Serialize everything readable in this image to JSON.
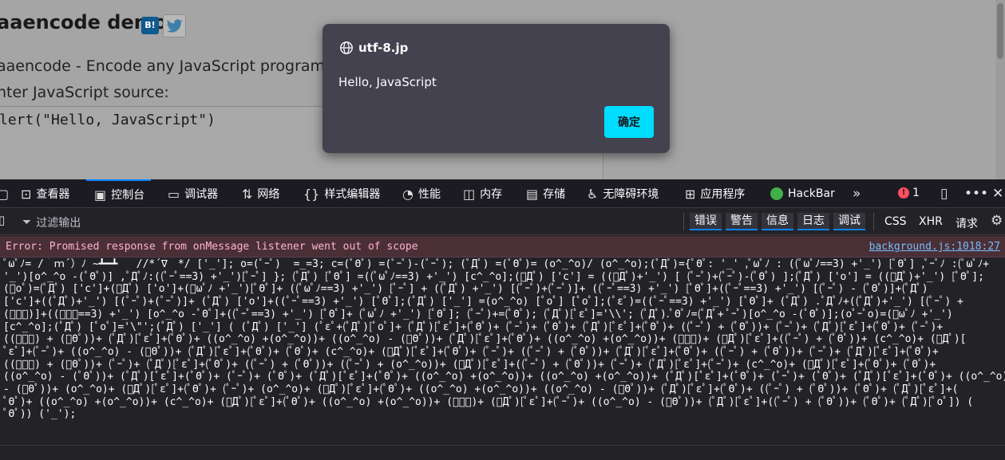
{
  "page": {
    "title": "aaencode demo",
    "hatena_label": "B!",
    "description": "aaencode - Encode any JavaScript program to",
    "source_label": "nter JavaScript source:",
    "source_value": "lert(\"Hello, JavaScript\")"
  },
  "dialog": {
    "host": "utf-8.jp",
    "message": "Hello, JavaScript",
    "ok_label": "确定"
  },
  "devtools": {
    "tabs": [
      {
        "label": "查看器",
        "icon": "inspector-icon"
      },
      {
        "label": "控制台",
        "icon": "console-icon"
      },
      {
        "label": "调试器",
        "icon": "debugger-icon"
      },
      {
        "label": "网络",
        "icon": "network-icon"
      },
      {
        "label": "样式编辑器",
        "icon": "style-editor-icon"
      },
      {
        "label": "性能",
        "icon": "performance-icon"
      },
      {
        "label": "内存",
        "icon": "memory-icon"
      },
      {
        "label": "存储",
        "icon": "storage-icon"
      },
      {
        "label": "无障碍环境",
        "icon": "accessibility-icon"
      },
      {
        "label": "应用程序",
        "icon": "application-icon"
      },
      {
        "label": "HackBar",
        "icon": "hackbar-icon"
      }
    ],
    "active_tab": "控制台",
    "error_count": "1",
    "filter_placeholder": "过滤输出",
    "levels": [
      "错误",
      "警告",
      "信息",
      "日志",
      "调试"
    ],
    "extra_filters": [
      "CSS",
      "XHR",
      "请求"
    ]
  },
  "console": {
    "error_message": "Error: Promised response from onMessage listener went out of scope",
    "error_source": "background.js:1018:27",
    "output_lines": [
      "ﾟωﾟﾉ= /｀ｍ´）ﾉ ~┻━┻   //*´∇｀*/ ['_']; o=(ﾟｰﾟ)  =_=3; c=(ﾟΘﾟ) =(ﾟｰﾟ)-(ﾟｰﾟ); (ﾟДﾟ) =(ﾟΘﾟ)= (o^_^o)/ (o^_^o);(ﾟДﾟ)={ﾟΘﾟ: '_' ,ﾟωﾟﾉ : ((ﾟωﾟﾉ==3) +'_') [ﾟΘﾟ] ,ﾟｰﾟﾉ :(ﾟωﾟﾉ+",
      "'_')[o^_^o -(ﾟΘﾟ)] ,ﾟДﾟﾉ:((ﾟｰﾟ==3) +'_')[ﾟｰﾟ] }; (ﾟДﾟ) [ﾟΘﾟ] =((ﾟωﾟﾉ==3) +'_') [c^_^o];(ﾟДﾟ) ['c'] = ((ﾟДﾟ)+'_') [ (ﾟｰﾟ)+(ﾟｰﾟ)-(ﾟΘﾟ) ];(ﾟДﾟ) ['o'] = ((ﾟДﾟ)+'_') [ﾟΘﾟ];",
      "(ﾟoﾟ)=(ﾟДﾟ) ['c']+(ﾟДﾟ) ['o']+(ﾟωﾟﾉ +'_')[ﾟΘﾟ]+ ((ﾟωﾟﾉ==3) +'_') [ﾟｰﾟ] + ((ﾟДﾟ) +'_') [(ﾟｰﾟ)+(ﾟｰﾟ)]+ ((ﾟｰﾟ==3) +'_') [ﾟΘﾟ]+((ﾟｰﾟ==3) +'_') [(ﾟｰﾟ) - (ﾟΘﾟ)]+(ﾟДﾟ)",
      "['c']+((ﾟДﾟ)+'_') [(ﾟｰﾟ)+(ﾟｰﾟ)]+ (ﾟДﾟ) ['o']+((ﾟｰﾟ==3) +'_') [ﾟΘﾟ];(ﾟДﾟ) ['_'] =(o^_^o) [ﾟoﾟ] [ﾟoﾟ];(ﾟεﾟ)=((ﾟｰﾟ==3) +'_') [ﾟΘﾟ]+ (ﾟДﾟ) .ﾟДﾟﾉ+((ﾟДﾟ)+'_') [(ﾟｰﾟ) +",
      "(ﾟｰﾟ)]+((ﾟｰﾟ==3) +'_') [o^_^o -ﾟΘﾟ]+((ﾟｰﾟ==3) +'_') [ﾟΘﾟ]+ (ﾟωﾟﾉ +'_') [ﾟΘﾟ]; (ﾟｰﾟ)+=(ﾟΘﾟ); (ﾟДﾟ)[ﾟεﾟ]='\\\\'; (ﾟДﾟ).ﾟΘﾟﾉ=(ﾟДﾟ+ ﾟｰﾟ)[o^_^o -(ﾟΘﾟ)];(oﾟｰﾟo)=(ﾟωﾟﾉ +'_')",
      "[c^_^o];(ﾟДﾟ) [ﾟoﾟ]='\\\"';(ﾟДﾟ) ['_'] ( (ﾟДﾟ) ['_'] (ﾟεﾟ+(ﾟДﾟ)[ﾟoﾟ]+ (ﾟДﾟ)[ﾟεﾟ]+(ﾟΘﾟ)+ (ﾟｰﾟ)+ (ﾟΘﾟ)+ (ﾟДﾟ)[ﾟεﾟ]+(ﾟΘﾟ)+ ((ﾟｰﾟ) + (ﾟΘﾟ))+ (ﾟｰﾟ)+ (ﾟДﾟ)[ﾟεﾟ]+(ﾟΘﾟ)+ (ﾟｰﾟ)+",
      "((ﾟｰﾟ) + (ﾟΘﾟ))+ (ﾟДﾟ)[ﾟεﾟ]+(ﾟΘﾟ)+ ((o^_^o) +(o^_^o))+ ((o^_^o) - (ﾟΘﾟ))+ (ﾟДﾟ)[ﾟεﾟ]+(ﾟΘﾟ)+ ((o^_^o) +(o^_^o))+ (ﾟｰﾟ)+ (ﾟДﾟ)[ﾟεﾟ]+((ﾟｰﾟ) + (ﾟΘﾟ))+ (c^_^o)+ (ﾟДﾟ)[",
      "ﾟεﾟ]+(ﾟｰﾟ)+ ((o^_^o) - (ﾟΘﾟ))+ (ﾟДﾟ)[ﾟεﾟ]+(ﾟΘﾟ)+ (ﾟΘﾟ)+ (c^_^o)+ (ﾟДﾟ)[ﾟεﾟ]+(ﾟΘﾟ)+ (ﾟｰﾟ)+ ((ﾟｰﾟ) + (ﾟΘﾟ))+ (ﾟДﾟ)[ﾟεﾟ]+(ﾟΘﾟ)+ ((ﾟｰﾟ) + (ﾟΘﾟ))+ (ﾟｰﾟ)+ (ﾟДﾟ)[ﾟεﾟ]+(ﾟΘﾟ)+",
      "((ﾟｰﾟ) + (ﾟΘﾟ))+ (ﾟｰﾟ)+ (ﾟДﾟ)[ﾟεﾟ]+(ﾟΘﾟ)+ ((ﾟｰﾟ) + (ﾟΘﾟ))+ ((ﾟｰﾟ) + (o^_^o))+ (ﾟДﾟ)[ﾟεﾟ]+((ﾟｰﾟ) + (ﾟΘﾟ))+ (ﾟｰﾟ)+ (ﾟДﾟ)[ﾟεﾟ]+(ﾟｰﾟ)+ (c^_^o)+ (ﾟДﾟ)[ﾟεﾟ]+(ﾟΘﾟ)+ (ﾟΘﾟ)+",
      "((o^_^o) - (ﾟΘﾟ))+ (ﾟДﾟ)[ﾟεﾟ]+(ﾟΘﾟ)+ (ﾟｰﾟ)+ (ﾟΘﾟ)+ (ﾟДﾟ)[ﾟεﾟ]+(ﾟΘﾟ)+ ((o^_^o) +(o^_^o))+ ((o^_^o) +(o^_^o))+ (ﾟДﾟ)[ﾟεﾟ]+(ﾟΘﾟ)+ (ﾟｰﾟ)+ (ﾟΘﾟ)+ (ﾟДﾟ)[ﾟεﾟ]+(ﾟΘﾟ)+ ((o^_^o)",
      "- (ﾟΘﾟ))+ (o^_^o)+ (ﾟДﾟ)[ﾟεﾟ]+(ﾟΘﾟ)+ (ﾟｰﾟ)+ (o^_^o)+ (ﾟДﾟ)[ﾟεﾟ]+(ﾟΘﾟ)+ ((o^_^o) +(o^_^o))+ ((o^_^o) - (ﾟΘﾟ))+ (ﾟДﾟ)[ﾟεﾟ]+(ﾟΘﾟ)+ ((ﾟｰﾟ) + (ﾟΘﾟ))+ (ﾟΘﾟ)+ (ﾟДﾟ)[ﾟεﾟ]+(",
      "ﾟΘﾟ)+ ((o^_^o) +(o^_^o))+ (c^_^o)+ (ﾟДﾟ)[ﾟεﾟ]+(ﾟΘﾟ)+ ((o^_^o) +(o^_^o))+ (ﾟｰﾟ)+ (ﾟДﾟ)[ﾟεﾟ]+(ﾟｰﾟ)+ ((o^_^o) - (ﾟΘﾟ))+ (ﾟДﾟ)[ﾟεﾟ]+((ﾟｰﾟ) + (ﾟΘﾟ))+ (ﾟΘﾟ)+ (ﾟДﾟ)[ﾟoﾟ]) (",
      "ﾟΘﾟ)) ('_');"
    ]
  }
}
